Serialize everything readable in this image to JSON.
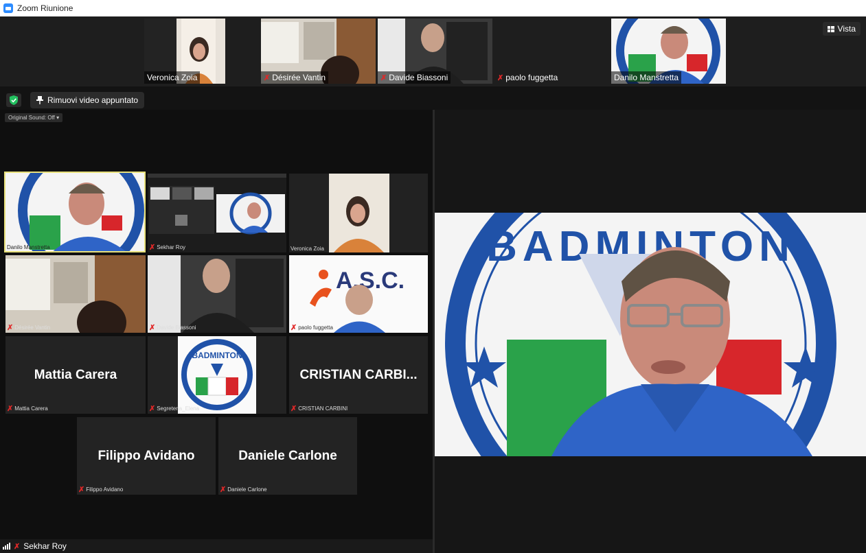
{
  "window": {
    "title": "Zoom Riunione"
  },
  "top_strip": {
    "view_label": "Vista",
    "thumbnails": [
      {
        "name": "Veronica Zoia",
        "muted": false
      },
      {
        "name": "Désirée Vantin",
        "muted": true
      },
      {
        "name": "Davide Biassoni",
        "muted": true
      },
      {
        "name": "paolo fuggetta",
        "muted": true
      },
      {
        "name": "Danilo Manstretta",
        "muted": false
      }
    ]
  },
  "toolbar": {
    "unpin_label": "Rimuovi video appuntato"
  },
  "shared_screen": {
    "original_sound": "Original Sound: Off",
    "tiles": [
      {
        "name": "Danilo Manstretta",
        "display": ""
      },
      {
        "name": "Sekhar Roy",
        "display": ""
      },
      {
        "name": "Veronica Zoia",
        "display": ""
      },
      {
        "name": "Désirée Vantin",
        "display": ""
      },
      {
        "name": "Davide Biassoni",
        "display": ""
      },
      {
        "name": "paolo fuggetta",
        "display": "",
        "logo_text": "A.S.C."
      },
      {
        "name": "Mattia Carera",
        "display": "Mattia Carera"
      },
      {
        "name": "Segreteria_Elena",
        "display": "",
        "logo_text": "BADMINTON"
      },
      {
        "name": "CRISTIAN CARBINI",
        "display": "CRISTIAN  CARBI..."
      },
      {
        "name": "Filippo Avidano",
        "display": "Filippo Avidano"
      },
      {
        "name": "Daniele Carlone",
        "display": "Daniele Carlone"
      }
    ]
  },
  "bottom_bar": {
    "name": "Sekhar Roy"
  },
  "main_video": {
    "logo_text": "BADMINTON"
  },
  "colors": {
    "accent": "#2d8cff",
    "muted": "#e02828",
    "speaker_border": "#e8e07a",
    "shirt": "#2f64c7"
  }
}
